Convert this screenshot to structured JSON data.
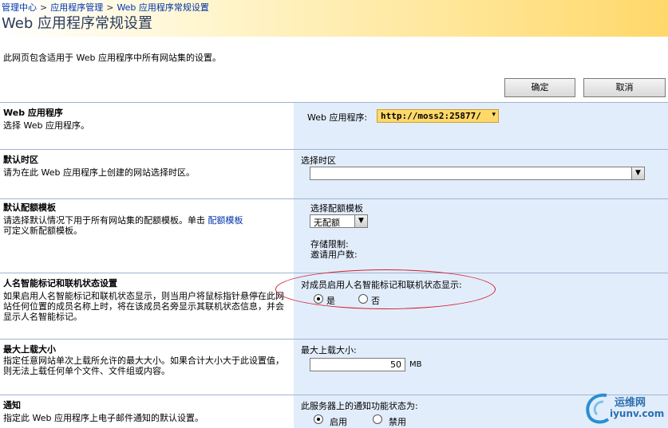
{
  "breadcrumb": [
    "管理中心",
    "应用程序管理",
    "Web 应用程序常规设置"
  ],
  "breadcrumb_sep": ">",
  "page_title": "Web 应用程序常规设置",
  "intro": "此网页包含适用于 Web 应用程序中所有网站集的设置。",
  "buttons": {
    "ok": "确定",
    "cancel": "取消"
  },
  "sections": {
    "webapp": {
      "title": "Web 应用程序",
      "desc": "选择 Web 应用程序。",
      "label": "Web 应用程序:",
      "value": "http://moss2:25877/"
    },
    "timezone": {
      "title": "默认时区",
      "desc": "请为在此 Web 应用程序上创建的网站选择时区。",
      "label": "选择时区",
      "value": ""
    },
    "quota": {
      "title": "默认配额模板",
      "desc_before": "请选择默认情况下用于所有网站集的配额模板。单击 ",
      "desc_link": "配额模板",
      "desc_after": "可定义新配额模板。",
      "label": "选择配额模板",
      "value": "无配额",
      "storage_label": "存储限制:",
      "invite_label": "邀请用户数:"
    },
    "presence": {
      "title": "人名智能标记和联机状态设置",
      "desc": "如果启用人名智能标记和联机状态显示，则当用户将鼠标指针悬停在此网站任何位置的成员名称上时，将在该成员名旁显示其联机状态信息，并会显示人名智能标记。",
      "label": "对成员启用人名智能标记和联机状态显示:",
      "yes": "是",
      "no": "否",
      "selected": "是"
    },
    "upload": {
      "title": "最大上载大小",
      "desc": "指定任意网站单次上载所允许的最大大小。如果合计大小大于此设置值，则无法上载任何单个文件、文件组或内容。",
      "label": "最大上载大小:",
      "value": "50",
      "unit": "MB"
    },
    "alerts": {
      "title": "通知",
      "desc": "指定此 Web 应用程序上电子邮件通知的默认设置。",
      "label": "此服务器上的通知功能状态为:",
      "on": "启用",
      "off": "禁用",
      "selected": "启用"
    }
  },
  "watermark": {
    "line1": "运维网",
    "line2": "iyunv.com"
  },
  "colors": {
    "header_gold": "#ffd86a",
    "right_panel": "#e2edfb",
    "annotation": "#d02030",
    "link": "#0033aa"
  }
}
